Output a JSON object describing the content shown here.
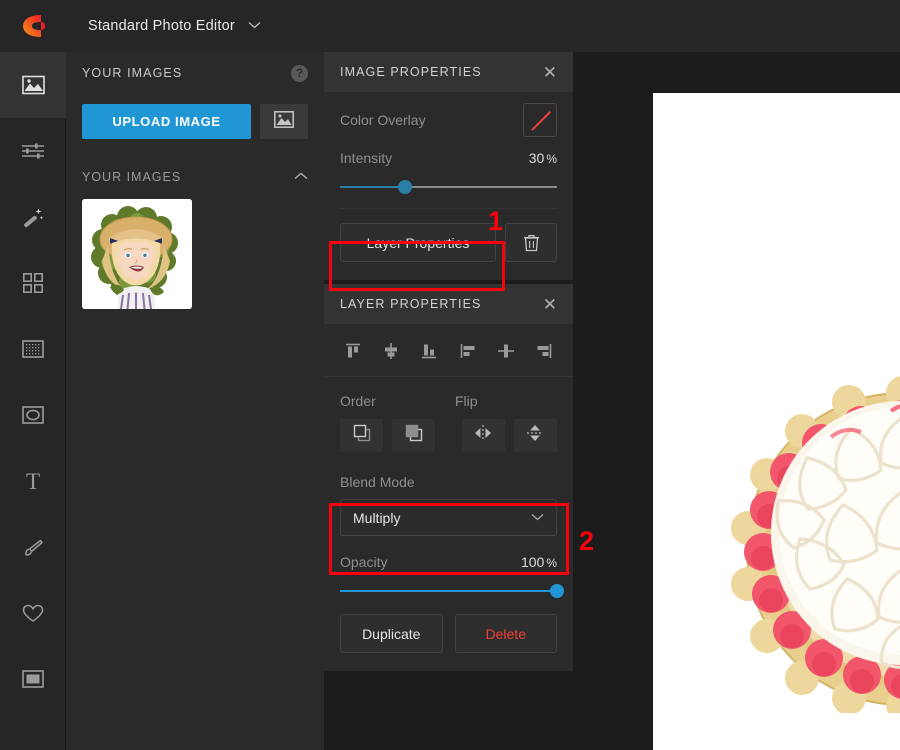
{
  "app": {
    "logo_name": "brand-logo",
    "title": "Standard Photo Editor",
    "title_chevron": "⌄"
  },
  "rail": {
    "items": [
      {
        "name": "images",
        "icon": "image-icon",
        "active": true
      },
      {
        "name": "adjust",
        "icon": "sliders-icon",
        "active": false
      },
      {
        "name": "effects",
        "icon": "magic-wand-icon",
        "active": false
      },
      {
        "name": "overlays",
        "icon": "grid-squares-icon",
        "active": false
      },
      {
        "name": "textures",
        "icon": "texture-icon",
        "active": false
      },
      {
        "name": "shapes",
        "icon": "shape-oval-icon",
        "active": false
      },
      {
        "name": "text",
        "icon": "text-t-icon",
        "active": false
      },
      {
        "name": "draw",
        "icon": "brush-icon",
        "active": false
      },
      {
        "name": "favorites",
        "icon": "heart-icon",
        "active": false
      },
      {
        "name": "frames",
        "icon": "frame-icon",
        "active": false
      }
    ]
  },
  "images_panel": {
    "title": "YOUR IMAGES",
    "help_glyph": "?",
    "upload_button": "UPLOAD IMAGE",
    "browse_icon": "picture-icon",
    "section_label": "YOUR IMAGES",
    "collapse_chevron": "⌃",
    "thumbnail_alt": "girl-in-straw-hat-thumbnail"
  },
  "image_properties": {
    "header": "IMAGE PROPERTIES",
    "close_glyph": "✕",
    "color_overlay_label": "Color Overlay",
    "color_overlay_value": "none",
    "color_overlay_slash_color": "#e8423f",
    "intensity_label": "Intensity",
    "intensity_value": "30",
    "intensity_unit": "%",
    "intensity_percent": 30,
    "layer_properties_button": "Layer Properties",
    "delete_icon": "trash-icon"
  },
  "layer_properties": {
    "header": "LAYER PROPERTIES",
    "close_glyph": "✕",
    "align_buttons": [
      {
        "name": "align-top-icon"
      },
      {
        "name": "align-vertical-center-icon"
      },
      {
        "name": "align-bottom-icon"
      },
      {
        "name": "align-left-icon"
      },
      {
        "name": "align-horizontal-center-icon"
      },
      {
        "name": "align-right-icon"
      }
    ],
    "order_label": "Order",
    "flip_label": "Flip",
    "order_buttons": [
      {
        "name": "bring-forward-icon"
      },
      {
        "name": "send-backward-icon"
      }
    ],
    "flip_buttons": [
      {
        "name": "flip-horizontal-icon"
      },
      {
        "name": "flip-vertical-icon"
      }
    ],
    "blend_mode_label": "Blend Mode",
    "blend_mode_value": "Multiply",
    "blend_mode_chevron": "⌄",
    "opacity_label": "Opacity",
    "opacity_value": "100",
    "opacity_unit": "%",
    "opacity_percent": 100,
    "duplicate_button": "Duplicate",
    "delete_button": "Delete",
    "delete_color": "#ef4136"
  },
  "canvas": {
    "name": "editor-canvas",
    "background": "#ffffff",
    "artwork": "cake-with-white-frosting-and-pink-piping"
  },
  "annotations": [
    {
      "number": "1",
      "target": "layer-properties-button"
    },
    {
      "number": "2",
      "target": "blend-mode-select"
    }
  ],
  "colors": {
    "accent_blue": "#2196d4",
    "annotation_red": "#f8000c",
    "panel_bg": "#2a2a2a",
    "chrome_bg": "#262626",
    "canvas_surround": "#1c1c1c"
  }
}
